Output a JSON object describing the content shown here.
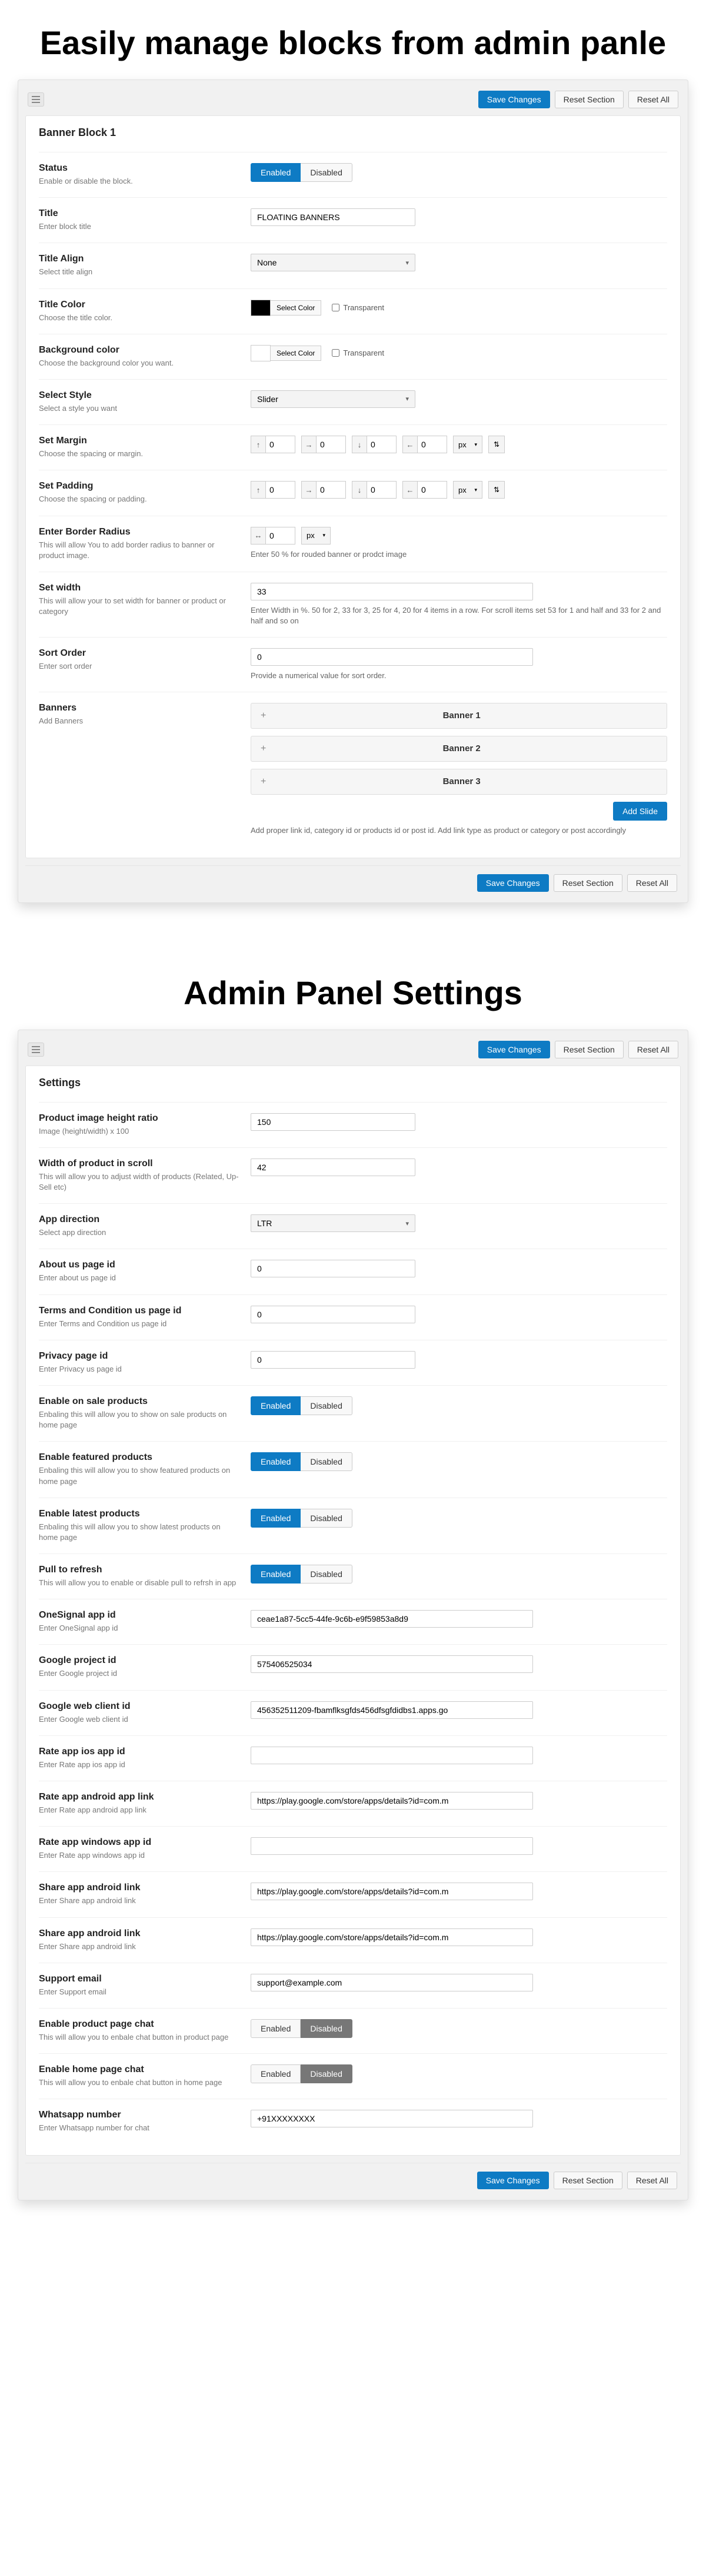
{
  "heading1": "Easily manage blocks from admin panle",
  "heading2": "Admin Panel Settings",
  "actions": {
    "save": "Save Changes",
    "resetSection": "Reset Section",
    "resetAll": "Reset All"
  },
  "b1": {
    "title": "Banner Block 1",
    "status": {
      "label": "Status",
      "desc": "Enable or disable the block.",
      "enabled": "Enabled",
      "disabled": "Disabled"
    },
    "titleField": {
      "label": "Title",
      "desc": "Enter block title",
      "value": "FLOATING BANNERS"
    },
    "titleAlign": {
      "label": "Title Align",
      "desc": "Select title align",
      "value": "None"
    },
    "titleColor": {
      "label": "Title Color",
      "desc": "Choose the title color.",
      "btn": "Select Color",
      "cb": "Transparent"
    },
    "bgColor": {
      "label": "Background color",
      "desc": "Choose the background color you want.",
      "btn": "Select Color",
      "cb": "Transparent"
    },
    "selectStyle": {
      "label": "Select Style",
      "desc": "Select a style you want",
      "value": "Slider"
    },
    "margin": {
      "label": "Set Margin",
      "desc": "Choose the spacing or margin.",
      "v": "0",
      "unit": "px"
    },
    "padding": {
      "label": "Set Padding",
      "desc": "Choose the spacing or padding.",
      "v": "0",
      "unit": "px"
    },
    "radius": {
      "label": "Enter Border Radius",
      "desc": "This will allow You to add border radius to banner or product image.",
      "v": "0",
      "unit": "px",
      "hint": "Enter 50 % for rouded banner or prodct image"
    },
    "width": {
      "label": "Set width",
      "desc": "This will allow your to set width for banner or product or category",
      "v": "33",
      "hint": "Enter Width in %. 50 for 2, 33 for 3, 25 for 4, 20 for 4 items in a row. For scroll items set 53 for 1 and half and 33 for 2 and half and so on"
    },
    "sort": {
      "label": "Sort Order",
      "desc": "Enter sort order",
      "v": "0",
      "hint": "Provide a numerical value for sort order."
    },
    "banners": {
      "label": "Banners",
      "desc": "Add Banners",
      "items": [
        "Banner 1",
        "Banner 2",
        "Banner 3"
      ],
      "add": "Add Slide",
      "hint": "Add proper link id, category id or products id or post id. Add link type as product or category or post accordingly"
    }
  },
  "s": {
    "title": "Settings",
    "ratio": {
      "label": "Product image height ratio",
      "desc": "Image (height/width) x 100",
      "v": "150"
    },
    "scrollWidth": {
      "label": "Width of product in scroll",
      "desc": "This will allow you to adjust width of products (Related, Up-Sell etc)",
      "v": "42"
    },
    "dir": {
      "label": "App direction",
      "desc": "Select app direction",
      "v": "LTR"
    },
    "about": {
      "label": "About us page id",
      "desc": "Enter about us page id",
      "v": "0"
    },
    "terms": {
      "label": "Terms and Condition us page id",
      "desc": "Enter Terms and Condition us page id",
      "v": "0"
    },
    "privacy": {
      "label": "Privacy page id",
      "desc": "Enter Privacy us page id",
      "v": "0"
    },
    "onSale": {
      "label": "Enable on sale products",
      "desc": "Enbaling this will allow you to show on sale products on home page"
    },
    "featured": {
      "label": "Enable featured products",
      "desc": "Enbaling this will allow you to show featured products on home page"
    },
    "latest": {
      "label": "Enable latest products",
      "desc": "Enbaling this will allow you to show latest products on home page"
    },
    "pull": {
      "label": "Pull to refresh",
      "desc": "This will allow you to enable or disable pull to refrsh in app"
    },
    "oneSignal": {
      "label": "OneSignal app id",
      "desc": "Enter OneSignal app id",
      "v": "ceae1a87-5cc5-44fe-9c6b-e9f59853a8d9"
    },
    "gProject": {
      "label": "Google project id",
      "desc": "Enter Google project id",
      "v": "575406525034"
    },
    "gWeb": {
      "label": "Google web client id",
      "desc": "Enter Google web client id",
      "v": "456352511209-fbamflksgfds456dfsgfdidbs1.apps.go"
    },
    "rateIos": {
      "label": "Rate app ios app id",
      "desc": "Enter Rate app ios app id",
      "v": ""
    },
    "rateAndroid": {
      "label": "Rate app android app link",
      "desc": "Enter Rate app android app link",
      "v": "https://play.google.com/store/apps/details?id=com.m"
    },
    "rateWin": {
      "label": "Rate app windows app id",
      "desc": "Enter Rate app windows app id",
      "v": ""
    },
    "shareAndroid": {
      "label": "Share app android link",
      "desc": "Enter Share app android link",
      "v": "https://play.google.com/store/apps/details?id=com.m"
    },
    "shareAndroid2": {
      "label": "Share app android link",
      "desc": "Enter Share app android link",
      "v": "https://play.google.com/store/apps/details?id=com.m"
    },
    "support": {
      "label": "Support email",
      "desc": "Enter Support email",
      "v": "support@example.com"
    },
    "prodChat": {
      "label": "Enable product page chat",
      "desc": "This will allow you to enbale chat button in product page"
    },
    "homeChat": {
      "label": "Enable home page chat",
      "desc": "This will allow you to enbale chat button in home page"
    },
    "whatsapp": {
      "label": "Whatsapp number",
      "desc": "Enter Whatsapp number for chat",
      "v": "+91XXXXXXXX"
    },
    "enabled": "Enabled",
    "disabled": "Disabled"
  }
}
